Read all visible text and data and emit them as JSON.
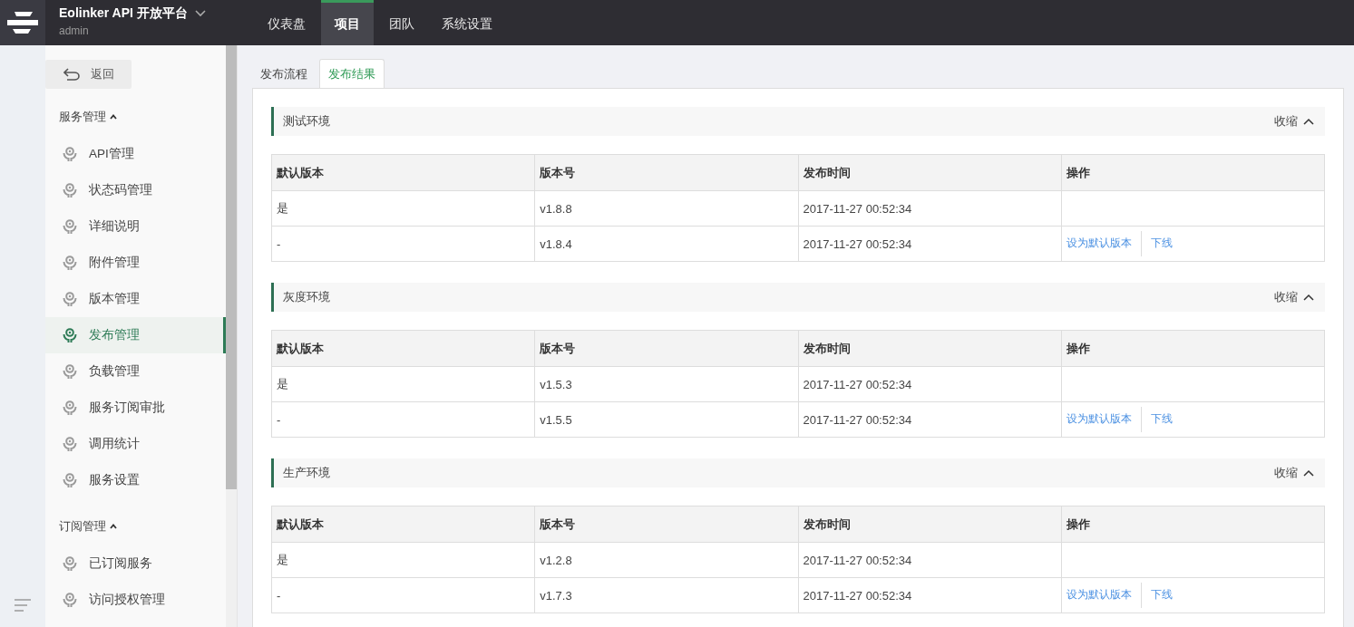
{
  "header": {
    "product": "Eolinker API 开放平台",
    "user": "admin"
  },
  "nav": [
    {
      "label": "仪表盘",
      "selected": false
    },
    {
      "label": "项目",
      "selected": true
    },
    {
      "label": "团队",
      "selected": false
    },
    {
      "label": "系统设置",
      "selected": false
    }
  ],
  "sidebar": {
    "back": "返回",
    "groups": [
      {
        "title": "服务管理",
        "expanded": true,
        "items": [
          {
            "label": "API管理",
            "selected": false
          },
          {
            "label": "状态码管理",
            "selected": false
          },
          {
            "label": "详细说明",
            "selected": false
          },
          {
            "label": "附件管理",
            "selected": false
          },
          {
            "label": "版本管理",
            "selected": false
          },
          {
            "label": "发布管理",
            "selected": true
          },
          {
            "label": "负载管理",
            "selected": false
          },
          {
            "label": "服务订阅审批",
            "selected": false
          },
          {
            "label": "调用统计",
            "selected": false
          },
          {
            "label": "服务设置",
            "selected": false
          }
        ]
      },
      {
        "title": "订阅管理",
        "expanded": true,
        "items": [
          {
            "label": "已订阅服务",
            "selected": false
          },
          {
            "label": "访问授权管理",
            "selected": false
          }
        ]
      }
    ]
  },
  "tabs": [
    {
      "label": "发布流程",
      "selected": false
    },
    {
      "label": "发布结果",
      "selected": true
    }
  ],
  "sections": [
    {
      "title": "测试环境",
      "toggle": "收缩",
      "expanded": true,
      "columns": [
        "默认版本",
        "版本号",
        "发布时间",
        "操作"
      ],
      "rows": [
        {
          "cells": [
            "是",
            "v1.8.8",
            "2017-11-27 00:52:34"
          ],
          "actions": []
        },
        {
          "cells": [
            "-",
            "v1.8.4",
            "2017-11-27 00:52:34"
          ],
          "actions": [
            "设为默认版本",
            "下线"
          ]
        }
      ]
    },
    {
      "title": "灰度环境",
      "toggle": "收缩",
      "expanded": true,
      "columns": [
        "默认版本",
        "版本号",
        "发布时间",
        "操作"
      ],
      "rows": [
        {
          "cells": [
            "是",
            "v1.5.3",
            "2017-11-27 00:52:34"
          ],
          "actions": []
        },
        {
          "cells": [
            "-",
            "v1.5.5",
            "2017-11-27 00:52:34"
          ],
          "actions": [
            "设为默认版本",
            "下线"
          ]
        }
      ]
    },
    {
      "title": "生产环境",
      "toggle": "收缩",
      "expanded": true,
      "columns": [
        "默认版本",
        "版本号",
        "发布时间",
        "操作"
      ],
      "rows": [
        {
          "cells": [
            "是",
            "v1.2.8",
            "2017-11-27 00:52:34"
          ],
          "actions": []
        },
        {
          "cells": [
            "-",
            "v1.7.3",
            "2017-11-27 00:52:34"
          ],
          "actions": [
            "设为默认版本",
            "下线"
          ]
        }
      ]
    }
  ]
}
